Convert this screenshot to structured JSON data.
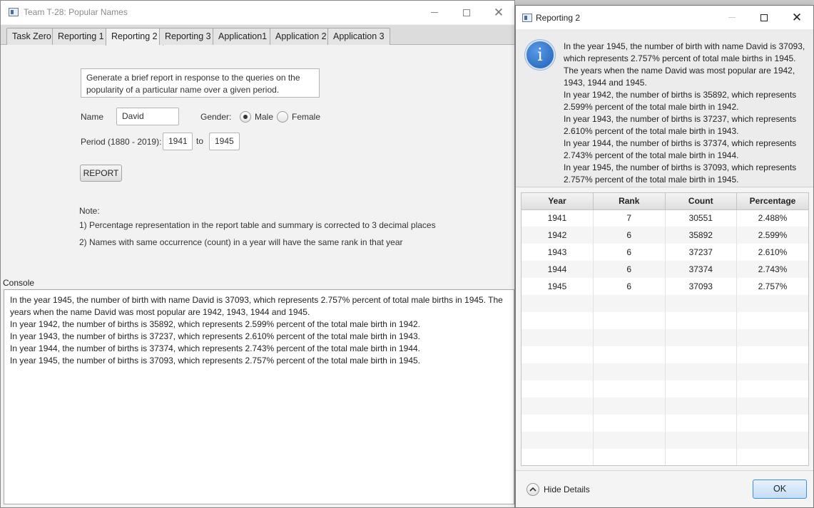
{
  "main_window": {
    "title": "Team T-28: Popular Names",
    "tabs": [
      {
        "label": "Task Zero"
      },
      {
        "label": "Reporting 1"
      },
      {
        "label": "Reporting 2"
      },
      {
        "label": "Reporting 3"
      },
      {
        "label": "Application1"
      },
      {
        "label": "Application 2"
      },
      {
        "label": "Application 3"
      }
    ],
    "active_tab": "Reporting 2",
    "description": "Generate a brief report in response to the queries on the popularity of a particular name over a given period.",
    "name_label": "Name",
    "name_value": "David",
    "gender_label": "Gender:",
    "gender_male": "Male",
    "gender_female": "Female",
    "gender_selected": "Male",
    "period_label": "Period (1880 - 2019):",
    "period_from": "1941",
    "period_to_label": "to",
    "period_to": "1945",
    "report_button": "REPORT",
    "note_title": "Note:",
    "note_1": "1) Percentage representation in the report table and summary is corrected to 3 decimal places",
    "note_2": "2) Names with same occurrence (count) in a year will have the same rank in that year",
    "console_label": "Console",
    "console_lines": [
      "In the year 1945, the number of birth with name David is 37093, which represents 2.757% percent of total male births in 1945. The years when the name David was most popular are 1942, 1943, 1944 and 1945.",
      "In year 1942, the number of births is 35892, which represents 2.599% percent of the total male birth in 1942.",
      "In year 1943, the number of births is 37237, which represents 2.610% percent of the total male birth in 1943.",
      "In year 1944, the number of births is 37374, which represents 2.743% percent of the total male birth in 1944.",
      "In year 1945, the number of births is 37093, which represents 2.757% percent of the total male birth in 1945."
    ]
  },
  "dialog": {
    "title": "Reporting 2",
    "message_lines": [
      "In the year 1945, the number of birth with name David is 37093, which represents 2.757% percent of total male births in 1945. The years when the name David was most popular are 1942, 1943, 1944 and 1945.",
      "In year 1942, the number of births is 35892, which represents 2.599% percent of the total male birth in 1942.",
      "In year 1943, the number of births is 37237, which represents 2.610% percent of the total male birth in 1943.",
      "In year 1944, the number of births is 37374, which represents 2.743% percent of the total male birth in 1944.",
      "In year 1945, the number of births is 37093, which represents 2.757% percent of the total male birth in 1945."
    ],
    "table": {
      "columns": [
        "Year",
        "Rank",
        "Count",
        "Percentage"
      ],
      "rows": [
        [
          "1941",
          "7",
          "30551",
          "2.488%"
        ],
        [
          "1942",
          "6",
          "35892",
          "2.599%"
        ],
        [
          "1943",
          "6",
          "37237",
          "2.610%"
        ],
        [
          "1944",
          "6",
          "37374",
          "2.743%"
        ],
        [
          "1945",
          "6",
          "37093",
          "2.757%"
        ]
      ]
    },
    "hide_details": "Hide Details",
    "ok_button": "OK"
  }
}
